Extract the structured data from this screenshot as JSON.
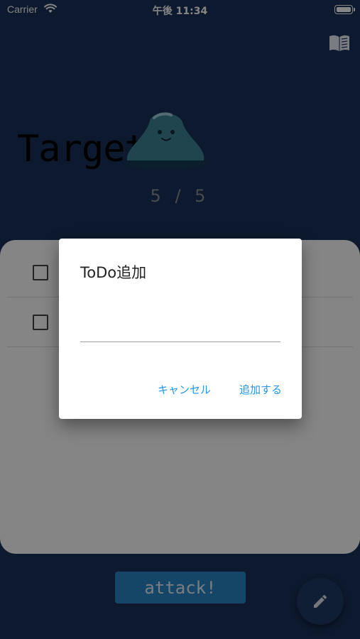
{
  "status_bar": {
    "carrier": "Carrier",
    "time": "午後 11:34"
  },
  "header": {
    "title": "Target",
    "progress": "5 / 5"
  },
  "todo_list": {
    "rows": [
      {
        "checked": false
      },
      {
        "checked": false
      }
    ]
  },
  "attack_button": {
    "label": "attack!"
  },
  "dialog": {
    "title": "ToDo追加",
    "input_value": "",
    "cancel_label": "キャンセル",
    "add_label": "追加する"
  },
  "colors": {
    "background": "#193058",
    "accent": "#2196f3",
    "attack_button": "#2a86c8"
  },
  "icons": [
    "wifi-icon",
    "battery-icon",
    "book-icon",
    "slime-icon",
    "edit-pencil-icon"
  ]
}
